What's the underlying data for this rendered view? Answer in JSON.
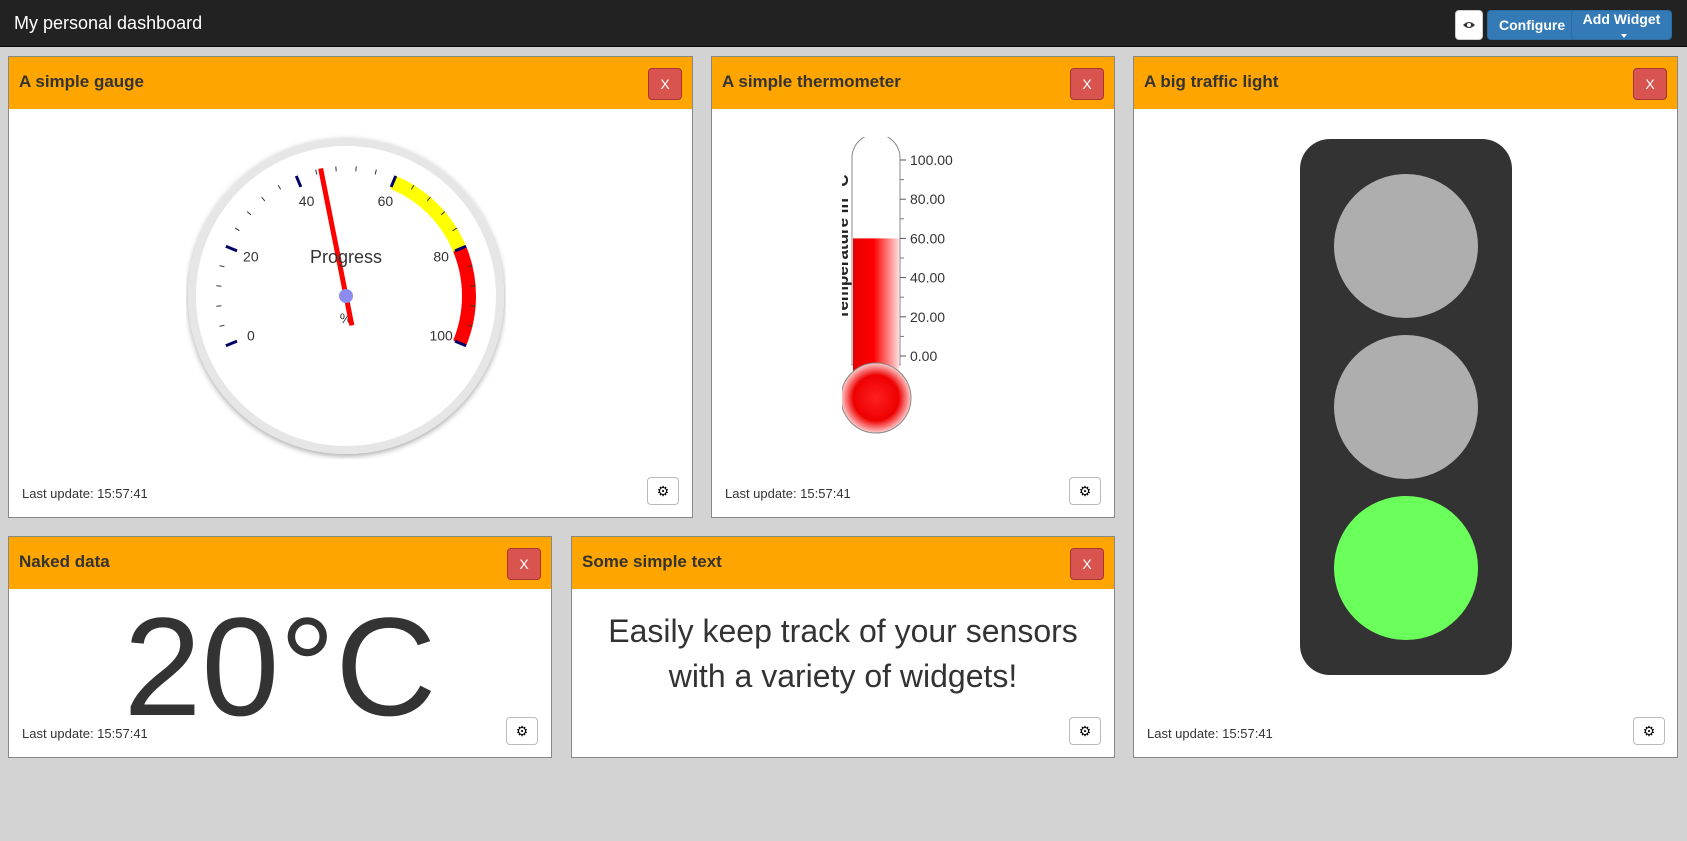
{
  "navbar": {
    "title": "My personal dashboard",
    "configure_label": "Configure",
    "add_widget_label": "Add Widget"
  },
  "common": {
    "close_label": "X",
    "last_update": "Last update: 15:57:41"
  },
  "widgets": {
    "gauge": {
      "title": "A simple gauge",
      "label": "Progress",
      "unit": "%",
      "value": 45,
      "min": 0,
      "max": 100,
      "major_ticks": [
        "0",
        "20",
        "40",
        "60",
        "80",
        "100"
      ],
      "warning_from": 60,
      "warning_to": 80,
      "danger_from": 80,
      "danger_to": 100,
      "warning_color": "#ffff00",
      "danger_color": "#ff0000",
      "needle_color": "#ff0000"
    },
    "thermometer": {
      "title": "A simple thermometer",
      "axis_label": "Temperature in °C",
      "value": 60,
      "min": 0,
      "max": 100,
      "ticks": [
        "100.00",
        "80.00",
        "60.00",
        "40.00",
        "20.00",
        "0.00"
      ],
      "fill_color": "#ff0000"
    },
    "traffic_light": {
      "title": "A big traffic light",
      "active": "green",
      "housing_color": "#333333",
      "off_color": "#aeaeae",
      "green_color": "#6bff5c"
    },
    "naked_data": {
      "title": "Naked data",
      "value": "20°C"
    },
    "simple_text": {
      "title": "Some simple text",
      "text": "Easily keep track of your sensors with a variety of widgets!"
    }
  }
}
